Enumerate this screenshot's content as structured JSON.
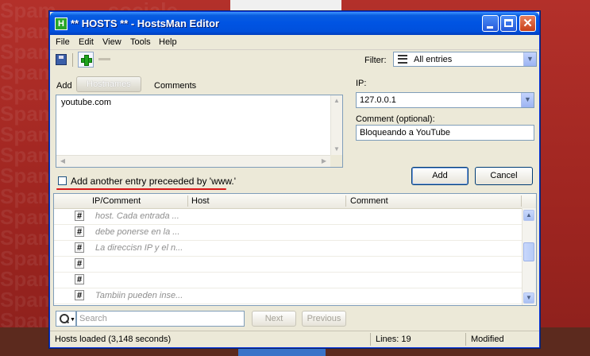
{
  "window": {
    "title": "** HOSTS ** - HostsMan Editor",
    "app_icon_letter": "H"
  },
  "menu": [
    "File",
    "Edit",
    "View",
    "Tools",
    "Help"
  ],
  "toolbar": {
    "filter_label": "Filter:",
    "filter_value": "All entries"
  },
  "editor": {
    "add_label": "Add",
    "tab_hostnames": "Hostnames",
    "tab_comments": "Comments",
    "hostnames_text": "youtube.com",
    "www_checkbox_label": "Add another entry preceeded by 'www.'",
    "www_checked": false,
    "ip_label": "IP:",
    "ip_value": "127.0.0.1",
    "comment_label": "Comment (optional):",
    "comment_value": "Bloqueando a YouTube",
    "add_button": "Add",
    "cancel_button": "Cancel"
  },
  "list": {
    "headers": [
      "IP/Comment",
      "Host",
      "Comment"
    ],
    "rows": [
      {
        "marker": "#",
        "text": "host. Cada entrada ..."
      },
      {
        "marker": "#",
        "text": "debe ponerse en la ..."
      },
      {
        "marker": "#",
        "text": "La direccisn IP y el n..."
      },
      {
        "marker": "#",
        "text": ""
      },
      {
        "marker": "#",
        "text": ""
      },
      {
        "marker": "#",
        "text": "Tambiin pueden inse..."
      },
      {
        "marker": "#",
        "text": ""
      }
    ]
  },
  "search": {
    "placeholder": "Search",
    "next_label": "Next",
    "previous_label": "Previous"
  },
  "status": {
    "message": "Hosts loaded (3,148 seconds)",
    "lines": "Lines: 19",
    "state": "Modified"
  },
  "colors": {
    "titlebar": "#0054e3",
    "underline_highlight": "#d81818",
    "desktop": "#a52a26"
  }
}
